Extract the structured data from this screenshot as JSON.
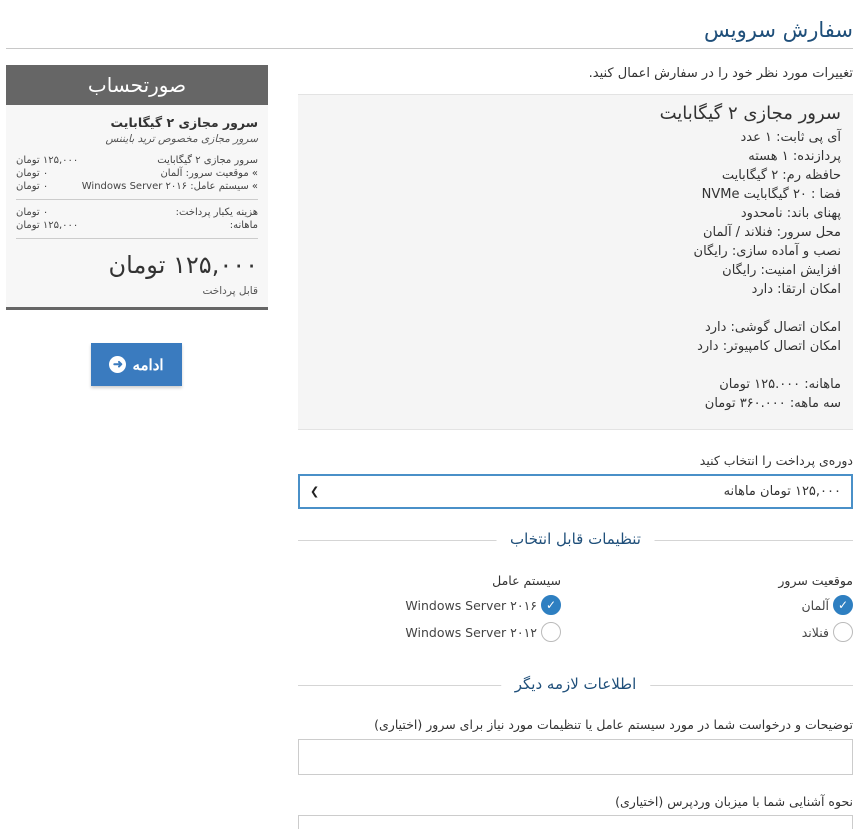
{
  "page": {
    "title": "سفارش سرویس",
    "intro": "تغییرات مورد نظر خود را در سفارش اعمال کنید."
  },
  "invoice": {
    "header": "صورتحساب",
    "product_title": "سرور مجازی ۲ گیگابایت",
    "product_subtitle": "سرور مجازی مخصوص ترید بایننس",
    "lines": [
      {
        "label": "سرور مجازی ۲ گیگابایت",
        "value": "۱۲۵,۰۰۰ تومان"
      },
      {
        "label": "» موقعیت سرور: آلمان",
        "value": "۰ تومان"
      },
      {
        "label": "» سیستم عامل: Windows Server ۲۰۱۶",
        "value": "۰ تومان"
      }
    ],
    "fees": [
      {
        "label": "هزینه یکبار پرداخت:",
        "value": "۰ تومان"
      },
      {
        "label": "ماهانه:",
        "value": "۱۲۵,۰۰۰ تومان"
      }
    ],
    "total": "۱۲۵,۰۰۰ تومان",
    "total_label": "قابل پرداخت",
    "continue_label": "ادامه"
  },
  "product": {
    "name": "سرور مجازی ۲ گیگابایت",
    "specs": [
      "آی پی ثابت: ۱ عدد",
      "پردازنده: ۱ هسته",
      "حافظه رم: ۲ گیگابایت",
      "فضا : ۲۰ گیگابایت NVMe",
      "پهنای باند: نامحدود",
      "محل سرور: فنلاند / آلمان",
      "نصب و آماده سازی: رایگان",
      "افزایش امنیت: رایگان",
      "امکان ارتقا: دارد"
    ],
    "access": [
      "امکان اتصال گوشی: دارد",
      "امکان اتصال کامپیوتر: دارد"
    ],
    "prices": [
      "ماهانه: ۱۲۵.۰۰۰ تومان",
      "سه ماهه: ۳۶۰.۰۰۰ تومان"
    ]
  },
  "billing": {
    "label": "دوره‌ی پرداخت را انتخاب کنید",
    "selected": "۱۲۵,۰۰۰ تومان ماهانه"
  },
  "config": {
    "section_title": "تنظیمات قابل انتخاب",
    "location_label": "موقعیت سرور",
    "location_options": [
      {
        "label": "آلمان",
        "checked": true
      },
      {
        "label": "فنلاند",
        "checked": false
      }
    ],
    "os_label": "سیستم عامل",
    "os_options": [
      {
        "label": "Windows Server ۲۰۱۶",
        "checked": true
      },
      {
        "label": "Windows Server ۲۰۱۲",
        "checked": false
      }
    ]
  },
  "extra": {
    "section_title": "اطلاعات لازمه دیگر",
    "field1_label": "توضیحات و درخواست شما در مورد سیستم عامل یا تنظیمات مورد نیاز برای سرور (اختیاری)",
    "field2_label": "نحوه آشنایی شما با میزبان وردپرس (اختیاری)"
  },
  "colors": {
    "accent": "#2e7fc1",
    "title": "#1f4f7a",
    "invoice_header": "#666666"
  },
  "icons": {
    "continue": "arrow-circle-right-icon",
    "select": "chevron-down-icon",
    "check": "check-icon"
  }
}
